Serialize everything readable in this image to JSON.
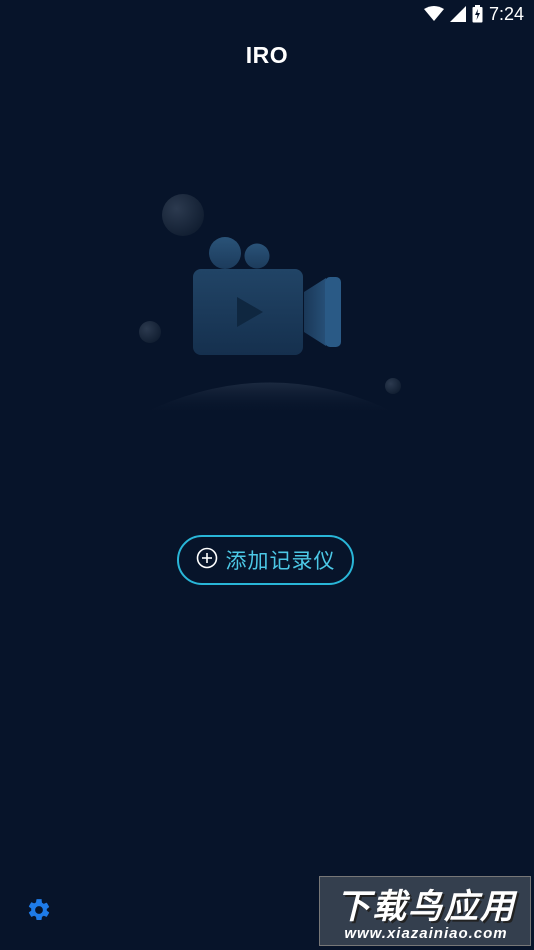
{
  "status_bar": {
    "time": "7:24",
    "icons": [
      "wifi-icon",
      "signal-icon",
      "battery-charging-icon"
    ]
  },
  "header": {
    "title": "IRO"
  },
  "illustration": {
    "icon": "video-camera-icon"
  },
  "main": {
    "add_button_label": "添加记录仪",
    "add_button_icon": "plus-circle-icon"
  },
  "footer": {
    "settings_icon": "gear-icon"
  },
  "watermark": {
    "title": "下载鸟应用",
    "url": "www.xiazainiao.com"
  },
  "colors": {
    "background": "#07142a",
    "accent": "#29b6d8",
    "settings": "#1e7be8"
  }
}
